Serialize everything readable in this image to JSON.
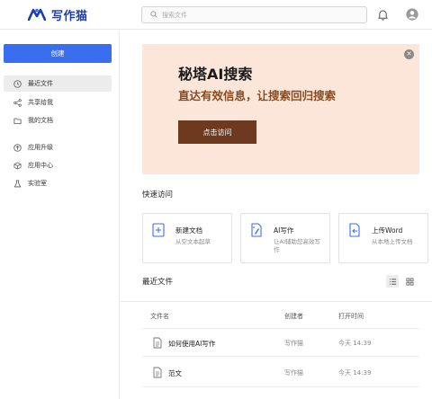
{
  "app": {
    "name": "写作猫",
    "brand_color": "#1f3fa8"
  },
  "header": {
    "search_placeholder": "搜索文件",
    "icons": [
      "search-icon",
      "bell-icon",
      "user-avatar-icon"
    ]
  },
  "sidebar": {
    "create_label": "创建",
    "items": [
      {
        "label": "最近文件",
        "icon": "clock-icon",
        "active": true
      },
      {
        "label": "共享给我",
        "icon": "share-icon",
        "active": false
      },
      {
        "label": "我的文档",
        "icon": "folder-icon",
        "active": false
      },
      {
        "label": "应用升级",
        "icon": "upgrade-icon",
        "active": false
      },
      {
        "label": "应用中心",
        "icon": "cube-icon",
        "active": false
      },
      {
        "label": "实验室",
        "icon": "flask-icon",
        "active": false
      }
    ]
  },
  "banner": {
    "title": "秘塔AI搜索",
    "subtitle": "直达有效信息，让搜索回归搜索",
    "button_label": "点击访问",
    "bg_color": "#fbe6d9",
    "button_color": "#6e3a1f"
  },
  "quick_access": {
    "title": "快速访问",
    "cards": [
      {
        "title": "新建文档",
        "desc": "从空文本起草",
        "icon": "new-doc-icon"
      },
      {
        "title": "AI写作",
        "desc": "让AI辅助您高效写作",
        "icon": "ai-write-icon"
      },
      {
        "title": "上传Word",
        "desc": "从本地上传文档",
        "icon": "upload-doc-icon"
      }
    ]
  },
  "recent": {
    "title": "最近文件",
    "columns": {
      "name": "文件名",
      "creator": "创建者",
      "opened": "打开时间"
    },
    "rows": [
      {
        "name": "如何使用AI写作",
        "creator": "写作猫",
        "opened": "今天 14:39"
      },
      {
        "name": "范文",
        "creator": "写作猫",
        "opened": "今天 14:39"
      }
    ]
  },
  "colors": {
    "accent": "#3a6ef0"
  }
}
